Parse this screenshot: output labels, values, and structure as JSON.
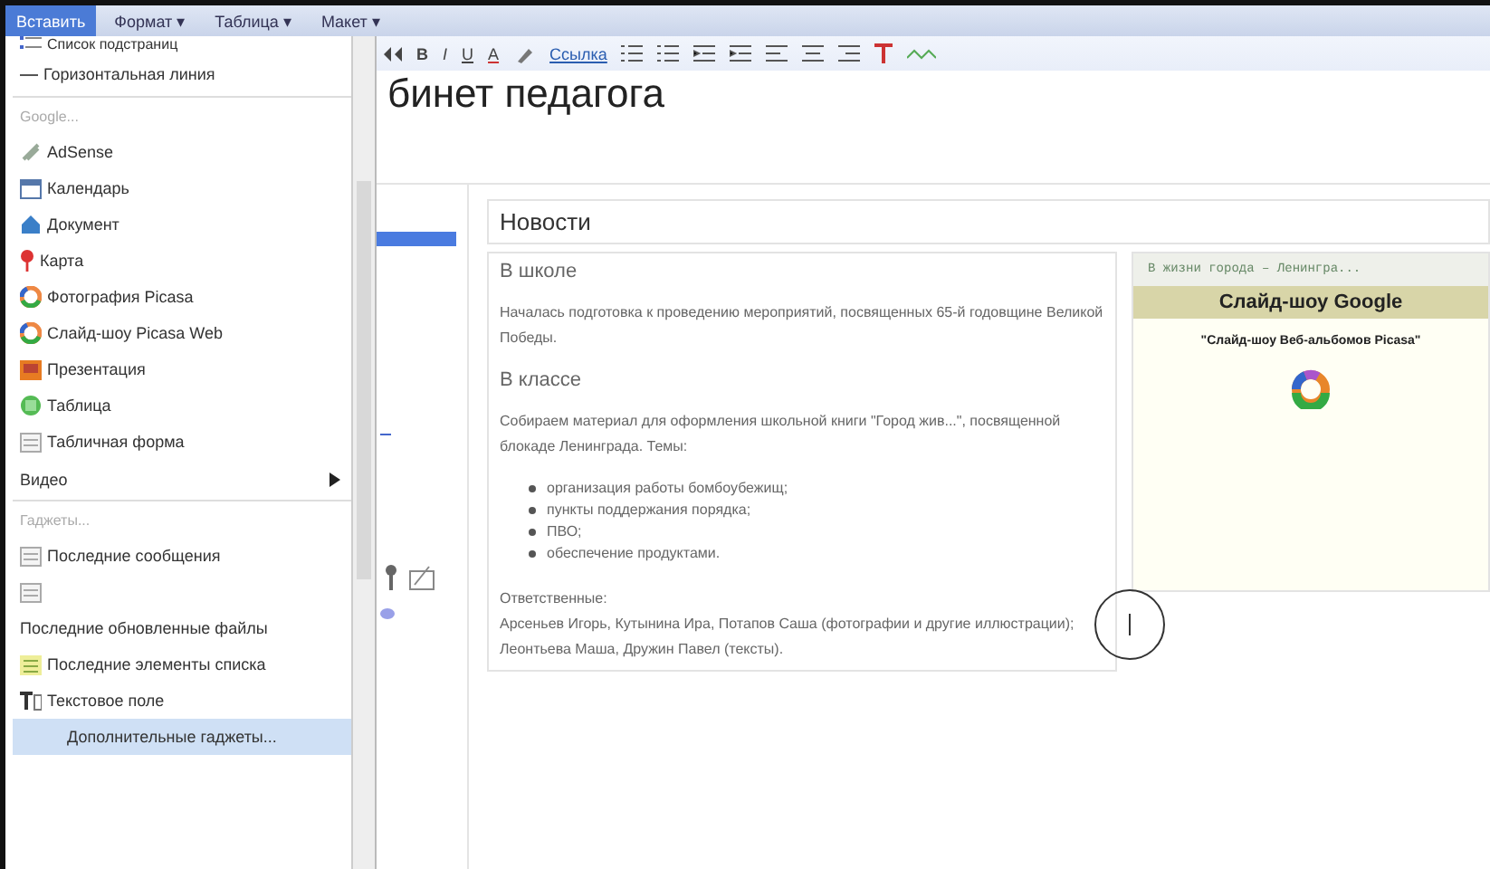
{
  "menu_bar": [
    {
      "label": "Вставить",
      "selected": true
    },
    {
      "label": "Формат ▾",
      "selected": false
    },
    {
      "label": "Таблица ▾",
      "selected": false
    },
    {
      "label": "Макет ▾",
      "selected": false
    }
  ],
  "toolbar": {
    "bold": "B",
    "italic": "I",
    "underline": "U",
    "text_color": "A",
    "link": "Ссылка"
  },
  "page_title": "бинет педагога",
  "insert_menu": [
    {
      "kind": "item",
      "label": "Список подстраниц"
    },
    {
      "kind": "item",
      "label": "Горизонтальная линия"
    },
    {
      "kind": "header",
      "label": "Google..."
    },
    {
      "kind": "item",
      "label": "AdSense"
    },
    {
      "kind": "item",
      "label": "Календарь"
    },
    {
      "kind": "item",
      "label": "Документ"
    },
    {
      "kind": "item",
      "label": "Карта"
    },
    {
      "kind": "item",
      "label": "Фотография Picasa"
    },
    {
      "kind": "item",
      "label": "Слайд-шоу Picasa Web"
    },
    {
      "kind": "item",
      "label": "Презентация"
    },
    {
      "kind": "item",
      "label": "Таблица"
    },
    {
      "kind": "item",
      "label": "Табличная форма"
    },
    {
      "kind": "submenu",
      "label": "Видео"
    },
    {
      "kind": "header",
      "label": "Гаджеты..."
    },
    {
      "kind": "item",
      "label": "Последние сообщения"
    },
    {
      "kind": "item"
    },
    {
      "kind": "item",
      "label": "Последние обновленные файлы"
    },
    {
      "kind": "item",
      "label": "Последние элементы списка"
    },
    {
      "kind": "item",
      "label": "Текстовое поле"
    },
    {
      "kind": "highlight",
      "label": "Дополнительные гаджеты..."
    }
  ],
  "news": {
    "title": "Новости",
    "blocks": [
      {
        "kind": "heading",
        "text": "В школе"
      },
      {
        "kind": "paragraph",
        "text": "Началась подготовка к проведению мероприятий, посвященных 65-й годовщине Великой Победы."
      },
      {
        "kind": "heading",
        "text": "В классе"
      },
      {
        "kind": "paragraph",
        "text": "Собираем материал для оформления школьной книги \"Город жив...\", посвященной блокаде Ленинграда. Темы:"
      },
      {
        "kind": "bullets",
        "items": [
          "организация работы бомбоубежищ;",
          "пункты поддержания порядка;",
          "ПВО;",
          "обеспечение продуктами."
        ]
      },
      {
        "kind": "lines",
        "items": [
          "Ответственные:",
          "Арсеньев Игорь, Кутынина Ира, Потапов Саша (фотографии и другие иллюстрации);",
          "Леонтьева Маша, Дружин Павел (тексты)."
        ]
      }
    ]
  },
  "gadget": {
    "header": "В жизни города – Ленингра...",
    "title": "Слайд-шоу Google",
    "caption": "\"Слайд-шоу Веб-альбомов Picasa\""
  }
}
